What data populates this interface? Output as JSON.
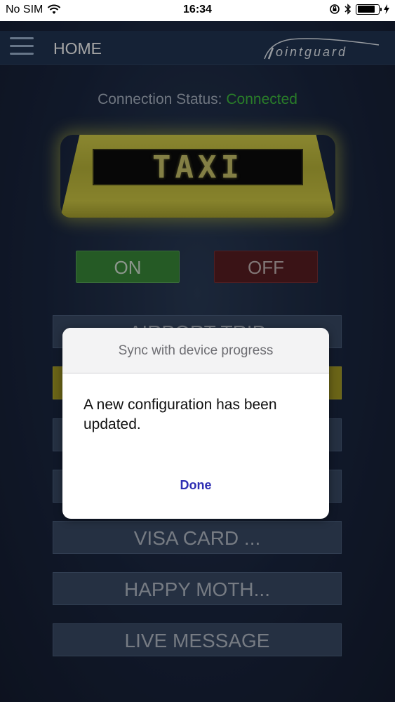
{
  "status_bar": {
    "carrier": "No SIM",
    "time": "16:34",
    "icons": [
      "wifi-icon",
      "orientation-lock-icon",
      "bluetooth-icon",
      "battery-icon",
      "charging-icon"
    ],
    "battery_level": 0.85
  },
  "navbar": {
    "title": "HOME",
    "logo_text": "ointguard"
  },
  "connection": {
    "label": "Connection Status:",
    "value": "Connected",
    "value_color": "#3fbf3f"
  },
  "sign": {
    "text": "TAXI",
    "body_color": "#c9c444"
  },
  "toggles": {
    "on_label": "ON",
    "off_label": "OFF",
    "on_color": "#3a8a3a",
    "off_color": "#5a1e23"
  },
  "messages": [
    {
      "label": "AIRPORT TRIP",
      "active": false
    },
    {
      "label": "",
      "active": true
    },
    {
      "label": "",
      "active": false
    },
    {
      "label": "",
      "active": false
    },
    {
      "label": "VISA CARD ...",
      "active": false
    },
    {
      "label": "HAPPY MOTH...",
      "active": false
    },
    {
      "label": "LIVE MESSAGE",
      "active": false
    }
  ],
  "dialog": {
    "title": "Sync with device progress",
    "message": "A new configuration has been updated.",
    "done_label": "Done"
  }
}
